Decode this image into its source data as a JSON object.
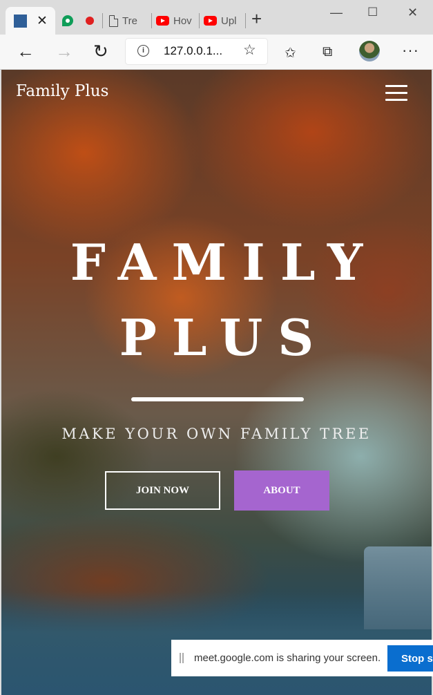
{
  "browser": {
    "tabs": [
      {
        "label": "",
        "icon": "page-favicon-icon",
        "active": true
      },
      {
        "label": "",
        "icon": "google-meet-icon"
      },
      {
        "label": "",
        "icon": "recording-dot-icon"
      },
      {
        "label": "Tre",
        "icon": "document-icon"
      },
      {
        "label": "Hov",
        "icon": "youtube-icon"
      },
      {
        "label": "Upl",
        "icon": "youtube-icon"
      }
    ],
    "tab_close_glyph": "✕",
    "new_tab_glyph": "+",
    "window_controls": {
      "minimize": "—",
      "maximize": "☐",
      "close": "✕"
    },
    "nav": {
      "back": "←",
      "forward": "→",
      "refresh": "↻"
    },
    "url": "127.0.0.1...",
    "info_glyph": "i",
    "star_glyph": "☆",
    "favorites_glyph": "✩",
    "collections_glyph": "⧉",
    "more_glyph": "···"
  },
  "site": {
    "brand": "Family Plus",
    "hero": {
      "title_line1": "FAMILY",
      "title_line2": "PLUS",
      "subtitle": "MAKE YOUR OWN FAMILY TREE",
      "join_label": "JOIN NOW",
      "about_label": "ABOUT"
    },
    "colors": {
      "about_button": "#a565cf",
      "stop_button": "#0a6ecf"
    }
  },
  "screen_share": {
    "message": "meet.google.com is sharing your screen.",
    "stop_label": "Stop sharing"
  }
}
